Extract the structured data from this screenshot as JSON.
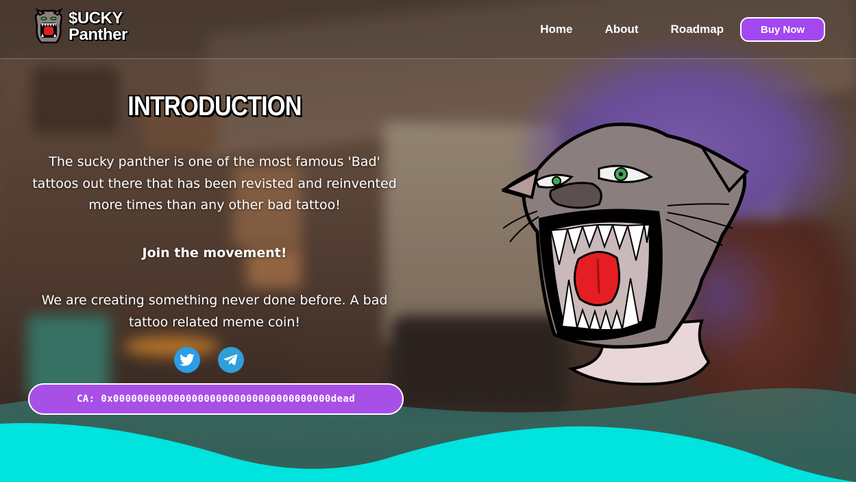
{
  "brand": {
    "line1": "$UCKY",
    "line2": "Panther",
    "icon": "panther-logo-icon"
  },
  "nav": {
    "home": "Home",
    "about": "About",
    "roadmap": "Roadmap",
    "buy": "Buy Now"
  },
  "intro": {
    "title": "INTRODUCTION",
    "paragraph1": "The sucky panther is one of the most famous 'Bad' tattoos out there that has been revisted and reinvented more times than any other bad tattoo!",
    "paragraph2": "Join the movement!",
    "paragraph3": "We are creating something never done before. A bad tattoo related meme coin!"
  },
  "socials": [
    {
      "name": "twitter",
      "icon": "twitter-icon"
    },
    {
      "name": "telegram",
      "icon": "telegram-icon"
    }
  ],
  "contract": {
    "text": "CA: 0x000000000000000000000000000000000000dead"
  },
  "colors": {
    "accent": "#a347f0",
    "wave": "#00e3de",
    "social": "#2a9de8"
  }
}
